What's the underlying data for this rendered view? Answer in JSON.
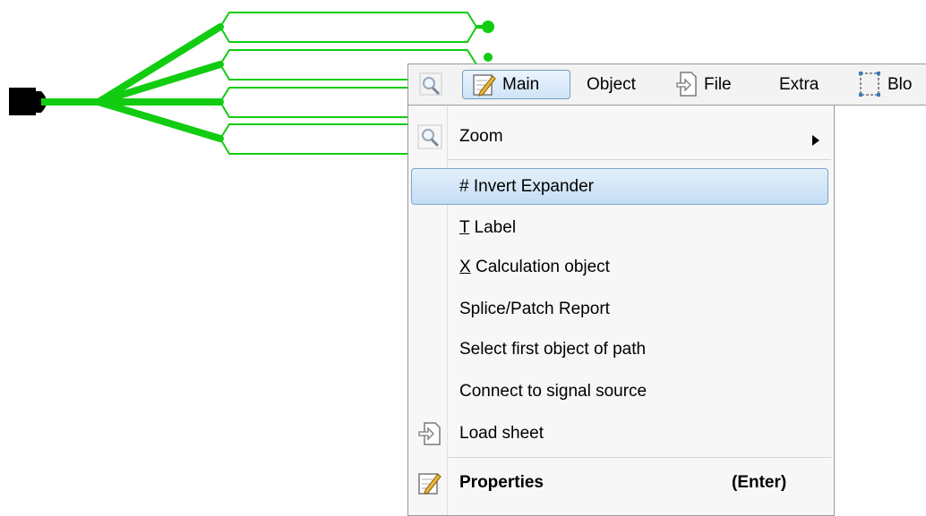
{
  "toolbar": {
    "main_label": "Main",
    "object_label": "Object",
    "file_label": "File",
    "extra_label": "Extra",
    "block_label": "Blo"
  },
  "menu": {
    "zoom": "Zoom",
    "invert_expander": "# Invert Expander",
    "label_key": "T",
    "label_text": "Label",
    "calc_key": "X",
    "calc_text": "Calculation object",
    "splice_report": "Splice/Patch Report",
    "select_first": "Select first object of path",
    "connect_signal": "Connect to signal source",
    "load_sheet": "Load sheet",
    "properties": "Properties",
    "properties_shortcut": "(Enter)"
  },
  "colors": {
    "fiber_green": "#11cc11",
    "highlight_border": "#7da2ce",
    "menu_bg": "#f7f7f7"
  }
}
